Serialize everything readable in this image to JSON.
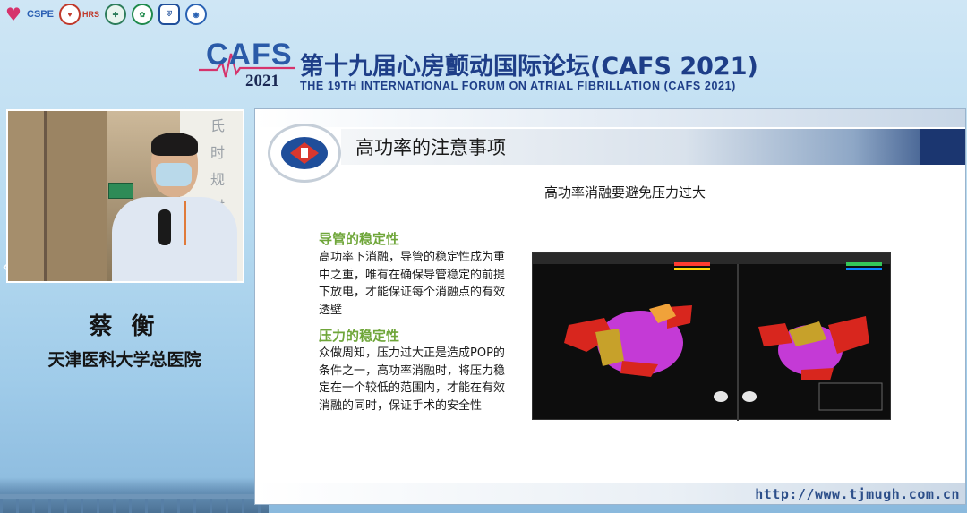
{
  "header": {
    "logos": {
      "cspe_text": "CSPE",
      "hrs_text": "HRS"
    },
    "cafs_word": "CAFS",
    "cafs_year": "2021",
    "title_cn": "第十九届心房颤动国际论坛(CAFS 2021)",
    "title_en": "THE 19TH INTERNATIONAL FORUM ON ATRIAL FIBRILLATION (CAFS 2021)"
  },
  "speaker": {
    "name": "蔡 衡",
    "organization": "天津医科大学总医院",
    "window_text": "氏时规时"
  },
  "navigation": {
    "prev": "‹",
    "next": "›"
  },
  "slide": {
    "title": "高功率的注意事项",
    "subtitle": "高功率消融要避免压力过大",
    "sections": [
      {
        "heading": "导管的稳定性",
        "body": "高功率下消融，导管的稳定性成为重中之重，唯有在确保导管稳定的前提下放电，才能保证每个消融点的有效透壁"
      },
      {
        "heading": "压力的稳定性",
        "body": "众做周知，压力过大正是造成POP的条件之一，高功率消融时，将压力稳定在一个较低的范围内，才能在有效消融的同时，保证手术的安全性"
      }
    ],
    "url": "http://www.tjmugh.com.cn"
  },
  "colors": {
    "title_blue": "#1e3e88",
    "section_green": "#6fa63a",
    "url_blue": "#2d4f8a"
  }
}
